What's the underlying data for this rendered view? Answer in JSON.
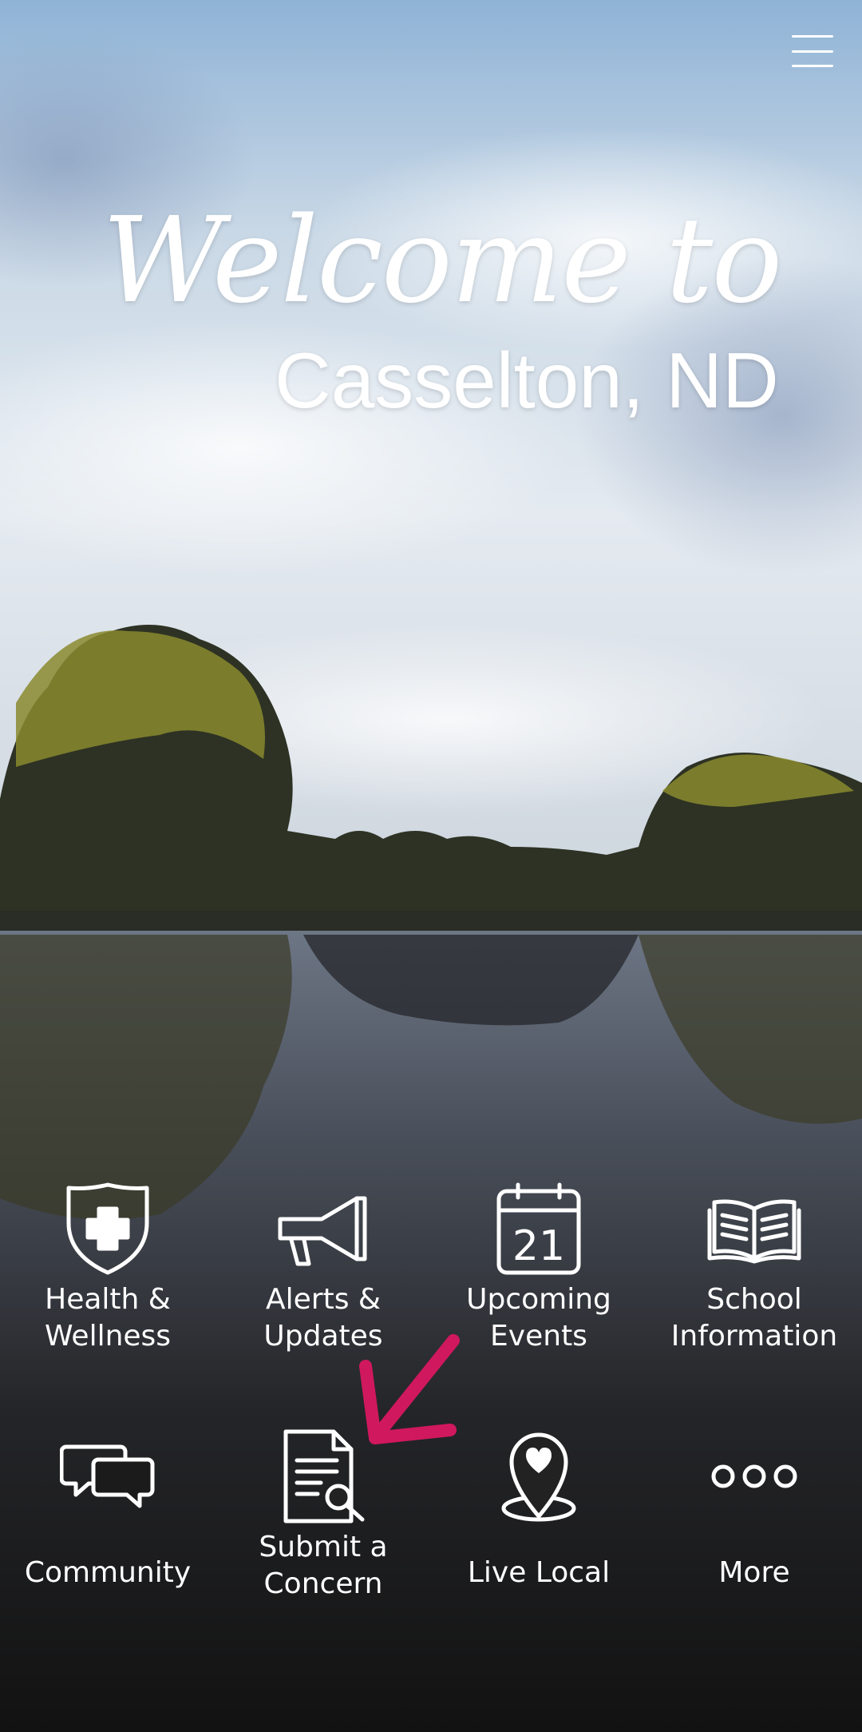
{
  "header": {
    "welcome_script": "Welcome to",
    "city": "Casselton, ND",
    "menu_icon": "hamburger-menu-icon"
  },
  "tiles": [
    {
      "label": "Health &\nWellness",
      "icon": "shield-plus-icon"
    },
    {
      "label": "Alerts &\nUpdates",
      "icon": "megaphone-icon"
    },
    {
      "label": "Upcoming\nEvents",
      "icon": "calendar-icon",
      "icon_text": "21"
    },
    {
      "label": "School\nInformation",
      "icon": "open-book-icon"
    },
    {
      "label": "Community",
      "icon": "chat-bubbles-icon"
    },
    {
      "label": "Submit a\nConcern",
      "icon": "document-search-icon"
    },
    {
      "label": "Live Local",
      "icon": "map-pin-heart-icon"
    },
    {
      "label": "More",
      "icon": "more-dots-icon"
    }
  ],
  "annotation": {
    "arrow_color": "#d0185e"
  }
}
